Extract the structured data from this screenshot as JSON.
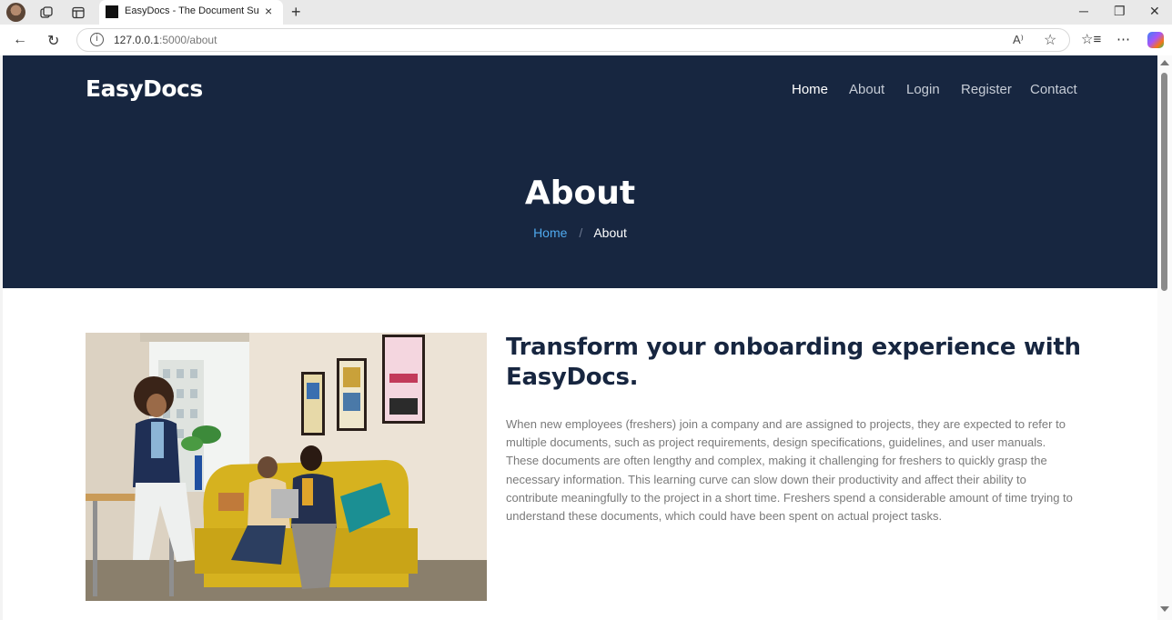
{
  "browser": {
    "tab_title": "EasyDocs - The Document Summ",
    "url_host": "127.0.0.1",
    "url_path": ":5000/about",
    "icons": {
      "profile": "profile-avatar",
      "workspaces": "workspaces-icon",
      "tab_actions": "tab-actions-icon",
      "tab_close": "×",
      "new_tab": "+",
      "minimize": "─",
      "restore": "❐",
      "close": "✕",
      "back": "←",
      "refresh": "↻",
      "site_info": "i",
      "read_aloud": "A⁾",
      "favorite": "☆",
      "favorites": "☆≡",
      "more": "⋯"
    }
  },
  "site": {
    "logo": "EasyDocs",
    "nav": [
      {
        "label": "Home",
        "active": true
      },
      {
        "label": "About",
        "active": false
      },
      {
        "label": "Login",
        "active": false
      },
      {
        "label": "Register",
        "active": false
      },
      {
        "label": "Contact",
        "active": false
      }
    ],
    "hero_title": "About",
    "breadcrumb": {
      "home": "Home",
      "separator": "/",
      "current": "About"
    }
  },
  "content": {
    "heading": "Transform your onboarding experience with EasyDocs.",
    "paragraph": "When new employees (freshers) join a company and are assigned to projects, they are expected to refer to multiple documents, such as project requirements, design specifications, guidelines, and user manuals. These documents are often lengthy and complex, making it challenging for freshers to quickly grasp the necessary information. This learning curve can slow down their productivity and affect their ability to contribute meaningfully to the project in a short time. Freshers spend a considerable amount of time trying to understand these documents, which could have been spent on actual project tasks."
  },
  "colors": {
    "hero_bg": "#172640",
    "breadcrumb_link": "#4fa9ee",
    "heading": "#172640",
    "body_text": "#7a7a7a"
  }
}
